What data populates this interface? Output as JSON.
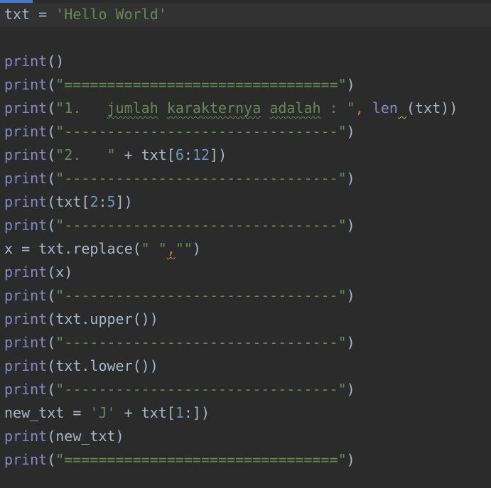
{
  "editor": {
    "accent_color": "#3d7bd6",
    "background": "#2b2b2b",
    "lines": [
      {
        "parts": [
          {
            "t": "txt = ",
            "c": "txt"
          },
          {
            "t": "'Hello World'",
            "c": "str"
          }
        ]
      },
      {
        "parts": []
      },
      {
        "parts": [
          {
            "t": "print",
            "c": "fn"
          },
          {
            "t": "()",
            "c": "txt"
          }
        ]
      },
      {
        "parts": [
          {
            "t": "print",
            "c": "fn"
          },
          {
            "t": "(",
            "c": "txt"
          },
          {
            "t": "\"================================\"",
            "c": "str"
          },
          {
            "t": ")",
            "c": "txt"
          }
        ]
      },
      {
        "parts": [
          {
            "t": "print",
            "c": "fn"
          },
          {
            "t": "(",
            "c": "txt"
          },
          {
            "t": "\"1.   ",
            "c": "str"
          },
          {
            "t": "jumlah",
            "c": "str",
            "u": "typo"
          },
          {
            "t": " ",
            "c": "str"
          },
          {
            "t": "karakternya",
            "c": "str",
            "u": "typo"
          },
          {
            "t": " ",
            "c": "str"
          },
          {
            "t": "adalah",
            "c": "str",
            "u": "typo"
          },
          {
            "t": " : \"",
            "c": "str"
          },
          {
            "t": ",",
            "c": "kw"
          },
          {
            "t": " ",
            "c": "txt"
          },
          {
            "t": "len",
            "c": "fn"
          },
          {
            "t": " ",
            "c": "txt",
            "u": "warn"
          },
          {
            "t": "(txt))",
            "c": "txt"
          }
        ]
      },
      {
        "parts": [
          {
            "t": "print",
            "c": "fn"
          },
          {
            "t": "(",
            "c": "txt"
          },
          {
            "t": "\"--------------------------------\"",
            "c": "str"
          },
          {
            "t": ")",
            "c": "txt"
          }
        ]
      },
      {
        "parts": [
          {
            "t": "print",
            "c": "fn"
          },
          {
            "t": "(",
            "c": "txt"
          },
          {
            "t": "\"2.   \"",
            "c": "str"
          },
          {
            "t": " + txt[",
            "c": "txt"
          },
          {
            "t": "6",
            "c": "num"
          },
          {
            "t": ":",
            "c": "txt"
          },
          {
            "t": "12",
            "c": "num"
          },
          {
            "t": "])",
            "c": "txt"
          }
        ]
      },
      {
        "parts": [
          {
            "t": "print",
            "c": "fn"
          },
          {
            "t": "(",
            "c": "txt"
          },
          {
            "t": "\"--------------------------------\"",
            "c": "str"
          },
          {
            "t": ")",
            "c": "txt"
          }
        ]
      },
      {
        "parts": [
          {
            "t": "print",
            "c": "fn"
          },
          {
            "t": "(txt[",
            "c": "txt"
          },
          {
            "t": "2",
            "c": "num"
          },
          {
            "t": ":",
            "c": "txt"
          },
          {
            "t": "5",
            "c": "num"
          },
          {
            "t": "])",
            "c": "txt"
          }
        ]
      },
      {
        "parts": [
          {
            "t": "print",
            "c": "fn"
          },
          {
            "t": "(",
            "c": "txt"
          },
          {
            "t": "\"--------------------------------\"",
            "c": "str"
          },
          {
            "t": ")",
            "c": "txt"
          }
        ]
      },
      {
        "parts": [
          {
            "t": "x = txt.replace(",
            "c": "txt"
          },
          {
            "t": "\" \"",
            "c": "str"
          },
          {
            "t": ",",
            "c": "kw",
            "u": "err"
          },
          {
            "t": "\"\"",
            "c": "str"
          },
          {
            "t": ")",
            "c": "txt"
          }
        ]
      },
      {
        "parts": [
          {
            "t": "print",
            "c": "fn"
          },
          {
            "t": "(x)",
            "c": "txt"
          }
        ]
      },
      {
        "parts": [
          {
            "t": "print",
            "c": "fn"
          },
          {
            "t": "(",
            "c": "txt"
          },
          {
            "t": "\"--------------------------------\"",
            "c": "str"
          },
          {
            "t": ")",
            "c": "txt"
          }
        ]
      },
      {
        "parts": [
          {
            "t": "print",
            "c": "fn"
          },
          {
            "t": "(txt.upper())",
            "c": "txt"
          }
        ]
      },
      {
        "parts": [
          {
            "t": "print",
            "c": "fn"
          },
          {
            "t": "(",
            "c": "txt"
          },
          {
            "t": "\"--------------------------------\"",
            "c": "str"
          },
          {
            "t": ")",
            "c": "txt"
          }
        ]
      },
      {
        "parts": [
          {
            "t": "print",
            "c": "fn"
          },
          {
            "t": "(txt.lower())",
            "c": "txt"
          }
        ]
      },
      {
        "parts": [
          {
            "t": "print",
            "c": "fn"
          },
          {
            "t": "(",
            "c": "txt"
          },
          {
            "t": "\"--------------------------------\"",
            "c": "str"
          },
          {
            "t": ")",
            "c": "txt"
          }
        ]
      },
      {
        "parts": [
          {
            "t": "new_txt = ",
            "c": "txt"
          },
          {
            "t": "'J'",
            "c": "str"
          },
          {
            "t": " + txt[",
            "c": "txt"
          },
          {
            "t": "1",
            "c": "num"
          },
          {
            "t": ":])",
            "c": "txt"
          }
        ]
      },
      {
        "parts": [
          {
            "t": "print",
            "c": "fn"
          },
          {
            "t": "(new_txt)",
            "c": "txt"
          }
        ]
      },
      {
        "parts": [
          {
            "t": "print",
            "c": "fn"
          },
          {
            "t": "(",
            "c": "txt"
          },
          {
            "t": "\"================================\"",
            "c": "str"
          },
          {
            "t": ")",
            "c": "txt"
          }
        ]
      }
    ]
  }
}
